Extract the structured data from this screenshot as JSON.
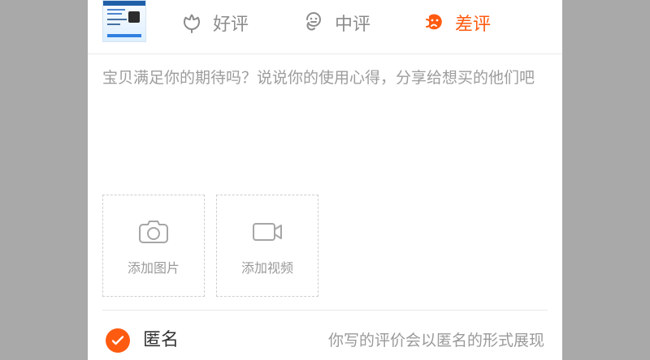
{
  "product": {
    "image_alt": "product thumbnail"
  },
  "ratings": [
    {
      "label": "好评",
      "icon_name": "flower-icon",
      "active": false
    },
    {
      "label": "中评",
      "icon_name": "meh-icon",
      "active": false
    },
    {
      "label": "差评",
      "icon_name": "sad-icon",
      "active": true
    }
  ],
  "review": {
    "placeholder": "宝贝满足你的期待吗？说说你的使用心得，分享给想买的他们吧",
    "value": ""
  },
  "media": {
    "photo_label": "添加图片",
    "video_label": "添加视频"
  },
  "anonymous": {
    "label": "匿名",
    "hint": "你写的评价会以匿名的形式展现",
    "checked": true
  },
  "colors": {
    "accent": "#ff5b10",
    "gray": "#8c8c8c",
    "background": "#a9a9a9"
  }
}
